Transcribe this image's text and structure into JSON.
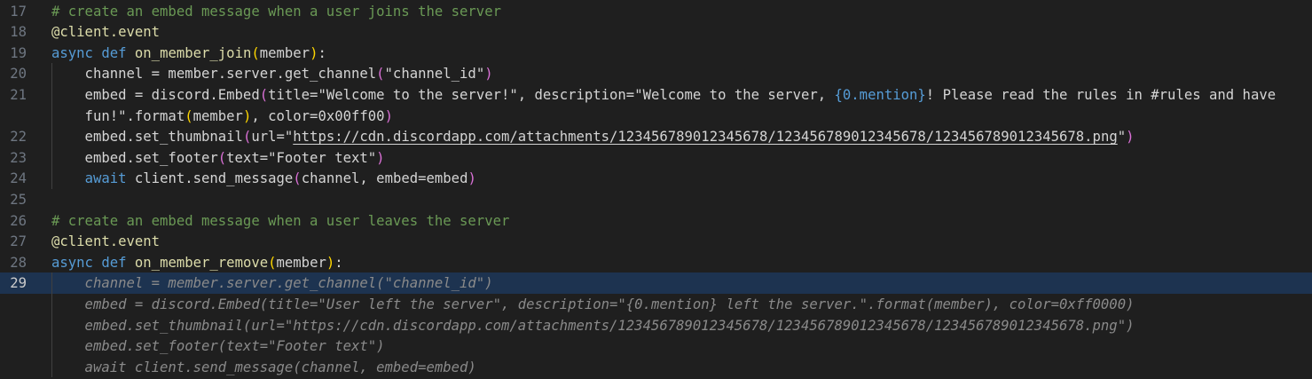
{
  "editor": {
    "language": "python",
    "current_line": "29",
    "lines": [
      {
        "num": "17",
        "segments": [
          {
            "t": "# create an embed message when a user joins the server",
            "c": "t-comment"
          }
        ]
      },
      {
        "num": "18",
        "segments": [
          {
            "t": "@client.event",
            "c": "t-deco"
          }
        ]
      },
      {
        "num": "19",
        "segments": [
          {
            "t": "async ",
            "c": "t-kw"
          },
          {
            "t": "def ",
            "c": "t-kw"
          },
          {
            "t": "on_member_join",
            "c": "t-fn"
          },
          {
            "t": "(",
            "c": "t-brace"
          },
          {
            "t": "member",
            "c": "t-plain"
          },
          {
            "t": ")",
            "c": "t-brace"
          },
          {
            "t": ":",
            "c": "t-plain"
          }
        ]
      },
      {
        "num": "20",
        "segments": [
          {
            "t": "    channel = member.server.",
            "c": "t-plain"
          },
          {
            "t": "get_channel",
            "c": "t-plain"
          },
          {
            "t": "(",
            "c": "t-brace2"
          },
          {
            "t": "\"channel_id\"",
            "c": "t-plain"
          },
          {
            "t": ")",
            "c": "t-brace2"
          }
        ]
      },
      {
        "num": "21",
        "segments": [
          {
            "t": "    embed = discord.",
            "c": "t-plain"
          },
          {
            "t": "Embed",
            "c": "t-plain"
          },
          {
            "t": "(",
            "c": "t-brace2"
          },
          {
            "t": "title=\"Welcome to the server!\", description=\"Welcome to the server, ",
            "c": "t-plain"
          },
          {
            "t": "{0.mention}",
            "c": "t-ph"
          },
          {
            "t": "! Please read the rules in #rules and have",
            "c": "t-plain"
          }
        ]
      },
      {
        "num": "",
        "segments": [
          {
            "t": "    fun!\".format",
            "c": "t-plain"
          },
          {
            "t": "(",
            "c": "t-brace"
          },
          {
            "t": "member",
            "c": "t-plain"
          },
          {
            "t": ")",
            "c": "t-brace"
          },
          {
            "t": ", color=0x00ff00",
            "c": "t-plain"
          },
          {
            "t": ")",
            "c": "t-brace2"
          }
        ]
      },
      {
        "num": "22",
        "segments": [
          {
            "t": "    embed.set_thumbnail",
            "c": "t-plain"
          },
          {
            "t": "(",
            "c": "t-brace2"
          },
          {
            "t": "url=\"",
            "c": "t-plain"
          },
          {
            "t": "https://cdn.discordapp.com/attachments/123456789012345678/123456789012345678/123456789012345678.png",
            "c": "t-plain u"
          },
          {
            "t": "\"",
            "c": "t-plain"
          },
          {
            "t": ")",
            "c": "t-brace2"
          }
        ]
      },
      {
        "num": "23",
        "segments": [
          {
            "t": "    embed.set_footer",
            "c": "t-plain"
          },
          {
            "t": "(",
            "c": "t-brace2"
          },
          {
            "t": "text=\"Footer text\"",
            "c": "t-plain"
          },
          {
            "t": ")",
            "c": "t-brace2"
          }
        ]
      },
      {
        "num": "24",
        "segments": [
          {
            "t": "    ",
            "c": "t-plain"
          },
          {
            "t": "await ",
            "c": "t-kw2"
          },
          {
            "t": "client.send_message",
            "c": "t-plain"
          },
          {
            "t": "(",
            "c": "t-brace2"
          },
          {
            "t": "channel, embed=embed",
            "c": "t-plain"
          },
          {
            "t": ")",
            "c": "t-brace2"
          }
        ]
      },
      {
        "num": "25",
        "segments": []
      },
      {
        "num": "26",
        "segments": [
          {
            "t": "# create an embed message when a user leaves the server",
            "c": "t-comment"
          }
        ]
      },
      {
        "num": "27",
        "segments": [
          {
            "t": "@client.event",
            "c": "t-deco"
          }
        ]
      },
      {
        "num": "28",
        "segments": [
          {
            "t": "async ",
            "c": "t-kw"
          },
          {
            "t": "def ",
            "c": "t-kw"
          },
          {
            "t": "on_member_remove",
            "c": "t-fn"
          },
          {
            "t": "(",
            "c": "t-brace"
          },
          {
            "t": "member",
            "c": "t-plain"
          },
          {
            "t": ")",
            "c": "t-brace"
          },
          {
            "t": ":",
            "c": "t-plain"
          }
        ]
      },
      {
        "num": "29",
        "current": true,
        "segments": [
          {
            "t": "    channel = member.server.get_channel(\"channel_id\")",
            "c": "ghost"
          }
        ]
      },
      {
        "num": "",
        "segments": [
          {
            "t": "    embed = discord.Embed(title=\"User left the server\", description=\"{0.mention} left the server.\".format(member), color=0xff0000)",
            "c": "ghost"
          }
        ]
      },
      {
        "num": "",
        "segments": [
          {
            "t": "    embed.set_thumbnail(url=\"https://cdn.discordapp.com/attachments/123456789012345678/123456789012345678/123456789012345678.png\")",
            "c": "ghost"
          }
        ]
      },
      {
        "num": "",
        "segments": [
          {
            "t": "    embed.set_footer(text=\"Footer text\")",
            "c": "ghost"
          }
        ]
      },
      {
        "num": "",
        "segments": [
          {
            "t": "    await client.send_message(channel, embed=embed)",
            "c": "ghost"
          }
        ]
      }
    ]
  }
}
